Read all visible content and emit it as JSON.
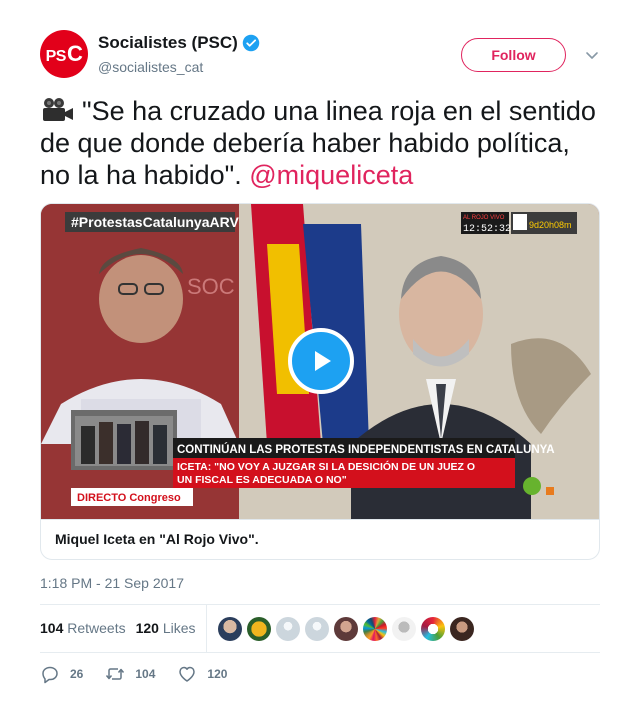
{
  "author": {
    "name": "Socialistes (PSC)",
    "handle": "@socialistes_cat",
    "avatar_text": "PSC",
    "verified": true,
    "brand_color": "#e2001a"
  },
  "follow_label": "Follow",
  "tweet": {
    "emoji_icon": "movie-camera-icon",
    "text": "\"Se ha cruzado una linea roja en el sentido de que donde debería haber habido política, no la ha habido\". ",
    "mention": "@miqueliceta",
    "accent_color": "#e0245e"
  },
  "video": {
    "hashtag_banner": "#ProtestasCatalunyaARV",
    "show_name": "AL ROJO VIVO",
    "clock": "12:52:32",
    "counter": "9d20h08m",
    "backdrop_text": "SOC",
    "headline": "CONTINÚAN LAS PROTESTAS INDEPENDENTISTAS EN CATALUNYA",
    "quote": "ICETA: \"NO VOY A JUZGAR SI LA DESICIÓN DE UN JUEZ O UN FISCAL ES ADECUADA O NO\"",
    "live_label": "DIRECTO Congreso"
  },
  "card_caption": "Miquel Iceta en \"Al Rojo Vivo\".",
  "timestamp": "1:18 PM - 21 Sep 2017",
  "stats": {
    "retweets_count": "104",
    "retweets_label": "Retweets",
    "likes_count": "120",
    "likes_label": "Likes"
  },
  "actions": {
    "replies": "26",
    "retweets": "104",
    "likes": "120"
  }
}
